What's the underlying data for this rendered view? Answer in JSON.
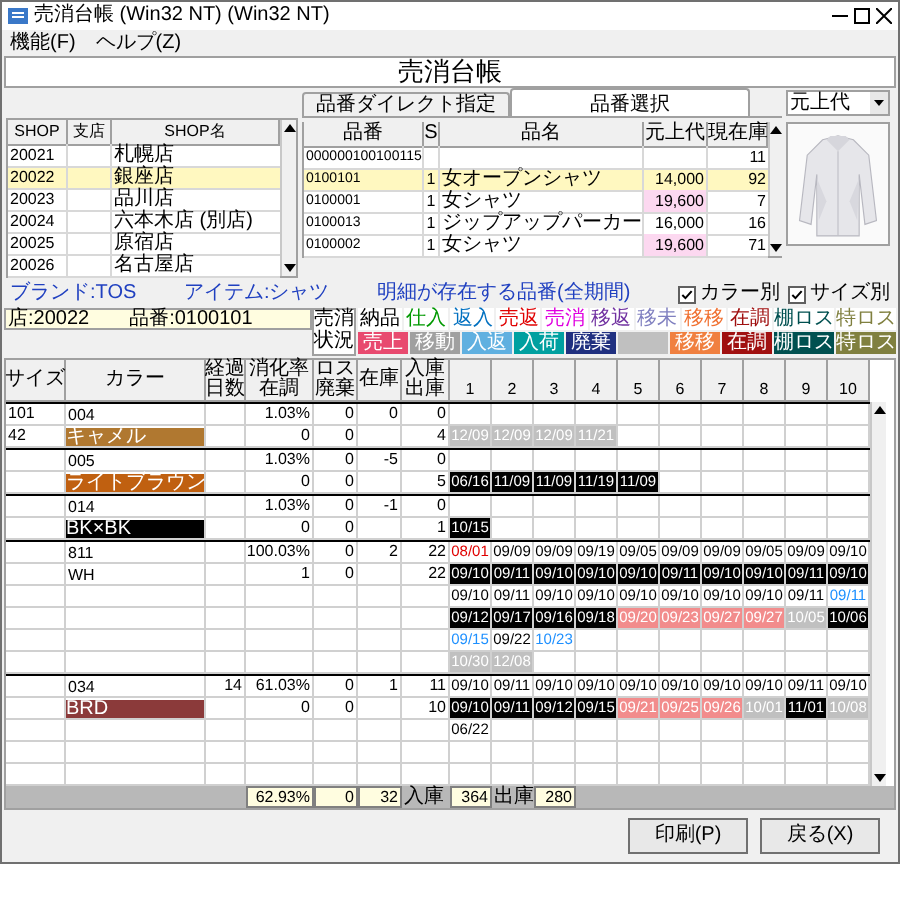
{
  "window": {
    "title": "売消台帳 (Win32 NT) (Win32 NT)"
  },
  "menu": [
    "機能(F)",
    "ヘルプ(Z)"
  ],
  "heading": "売消台帳",
  "shops": {
    "columns": [
      "SHOP",
      "支店",
      "SHOP名"
    ],
    "rows": [
      {
        "code": "20021",
        "name": "札幌店",
        "selected": false
      },
      {
        "code": "20022",
        "name": "銀座店",
        "selected": true
      },
      {
        "code": "20023",
        "name": "品川店",
        "selected": false
      },
      {
        "code": "20024",
        "name": "六本木店 (別店)",
        "selected": false
      },
      {
        "code": "20025",
        "name": "原宿店",
        "selected": false
      },
      {
        "code": "20026",
        "name": "名古屋店",
        "selected": false
      }
    ]
  },
  "tabs": [
    {
      "label": "品番ダイレクト指定",
      "selected": false
    },
    {
      "label": "品番選択",
      "selected": true
    }
  ],
  "price_select": {
    "value": "元上代"
  },
  "products": {
    "columns": [
      "品番",
      "S",
      "品名",
      "元上代",
      "現在庫"
    ],
    "rows": [
      {
        "code": "000000100100115",
        "stock": "11",
        "highlight": false,
        "selected": false
      },
      {
        "code": "0100101",
        "s": "1",
        "name": "女オープンシャツ",
        "price": "14,000",
        "stock": "92",
        "highlight": false,
        "selected": true
      },
      {
        "code": "0100001",
        "s": "1",
        "name": "女シャツ",
        "price": "19,600",
        "stock": "7",
        "highlight": true,
        "selected": false
      },
      {
        "code": "0100013",
        "s": "1",
        "name": "ジップアップパーカー",
        "price": "16,000",
        "stock": "16",
        "highlight": false,
        "selected": false
      },
      {
        "code": "0100002",
        "s": "1",
        "name": "女シャツ",
        "price": "19,600",
        "stock": "71",
        "highlight": true,
        "selected": false
      }
    ]
  },
  "info": {
    "brand": "ブランド:TOS",
    "item": "アイテム:シャツ",
    "filter": "明細が存在する品番(全期間)"
  },
  "options": [
    {
      "label": "カラー別",
      "checked": true
    },
    {
      "label": "サイズ別",
      "checked": true
    }
  ],
  "selection": {
    "shop": "店:20022",
    "code": "品番:0100101"
  },
  "legend": {
    "title": [
      "売消",
      "状況"
    ],
    "top": [
      {
        "label": "納品",
        "color": "#000000"
      },
      {
        "label": "仕入",
        "color": "#009900"
      },
      {
        "label": "返入",
        "color": "#0070c0"
      },
      {
        "label": "売返",
        "color": "#e00000"
      },
      {
        "label": "売消",
        "color": "#e000e0"
      },
      {
        "label": "移返",
        "color": "#7030a0"
      },
      {
        "label": "移未",
        "color": "#8080c0"
      },
      {
        "label": "移移",
        "color": "#f07030"
      },
      {
        "label": "在調",
        "color": "#a01010"
      },
      {
        "label": "棚ロス",
        "color": "#005050"
      },
      {
        "label": "特ロス",
        "color": "#808040"
      }
    ],
    "bottom": [
      {
        "label": "売上",
        "color": "#e84a6f"
      },
      {
        "label": "移動",
        "color": "#a0a0a0"
      },
      {
        "label": "入返",
        "color": "#60b0e0"
      },
      {
        "label": "入荷",
        "color": "#00a0a0"
      },
      {
        "label": "廃棄",
        "color": "#203080"
      },
      {
        "color": "#c0c0c0"
      },
      {
        "label": "移移",
        "color": "#f08040"
      },
      {
        "label": "在調",
        "color": "#a01010"
      },
      {
        "label": "棚ロス",
        "color": "#005050"
      },
      {
        "label": "特ロス",
        "color": "#808040"
      }
    ]
  },
  "grid": {
    "columns": [
      [
        "サイズ"
      ],
      [
        "カラー"
      ],
      [
        "経過",
        "日数"
      ],
      [
        "消化率",
        "在調"
      ],
      [
        "ロス",
        "廃棄"
      ],
      [
        "在庫"
      ],
      [
        "入庫",
        "出庫"
      ]
    ],
    "date_columns": [
      "1",
      "2",
      "3",
      "4",
      "5",
      "6",
      "7",
      "8",
      "9",
      "10"
    ],
    "rows": [
      {
        "divider": true,
        "size": "101",
        "color_label": "004",
        "rate": "1.03%",
        "loss": "0",
        "stock": "0",
        "io": "0"
      },
      {
        "divider": false,
        "size": "42",
        "color_label": "キャメル",
        "color": "#b07830",
        "rate": "0",
        "loss": "0",
        "io": "4",
        "dates": [
          {
            "text": "12/09",
            "kind": "gray"
          },
          {
            "text": "12/09",
            "kind": "gray"
          },
          {
            "text": "12/09",
            "kind": "gray"
          },
          {
            "text": "11/21",
            "kind": "gray"
          }
        ]
      },
      {
        "divider": true,
        "color_label": "005",
        "rate": "1.03%",
        "loss": "0",
        "stock": "-5",
        "io": "0"
      },
      {
        "divider": false,
        "color_label": "ライトブラウン",
        "color": "#c06010",
        "rate": "0",
        "loss": "0",
        "io": "5",
        "dates": [
          {
            "text": "06/16",
            "kind": "black"
          },
          {
            "text": "11/09",
            "kind": "black"
          },
          {
            "text": "11/09",
            "kind": "black"
          },
          {
            "text": "11/19",
            "kind": "black"
          },
          {
            "text": "11/09",
            "kind": "black"
          }
        ]
      },
      {
        "divider": true,
        "color_label": "014",
        "rate": "1.03%",
        "loss": "0",
        "stock": "-1",
        "io": "0"
      },
      {
        "divider": false,
        "color_label": "BK×BK",
        "color": "#000000",
        "rate": "0",
        "loss": "0",
        "io": "1",
        "dates": [
          {
            "text": "10/15",
            "kind": "black"
          }
        ]
      },
      {
        "divider": true,
        "color_label": "811",
        "rate": "100.03%",
        "loss": "0",
        "stock": "2",
        "io": "22",
        "dates": [
          {
            "text": "08/01",
            "kind": "red"
          },
          {
            "text": "09/09",
            "kind": "plain"
          },
          {
            "text": "09/09",
            "kind": "plain"
          },
          {
            "text": "09/19",
            "kind": "plain"
          },
          {
            "text": "09/05",
            "kind": "plain"
          },
          {
            "text": "09/09",
            "kind": "plain"
          },
          {
            "text": "09/09",
            "kind": "plain"
          },
          {
            "text": "09/05",
            "kind": "plain"
          },
          {
            "text": "09/09",
            "kind": "plain"
          },
          {
            "text": "09/10",
            "kind": "plain"
          }
        ]
      },
      {
        "divider": false,
        "color_label": "WH",
        "rate": "1",
        "loss": "0",
        "io": "22",
        "dates": [
          {
            "text": "09/10",
            "kind": "black"
          },
          {
            "text": "09/11",
            "kind": "black"
          },
          {
            "text": "09/10",
            "kind": "black"
          },
          {
            "text": "09/10",
            "kind": "black"
          },
          {
            "text": "09/10",
            "kind": "black"
          },
          {
            "text": "09/11",
            "kind": "black"
          },
          {
            "text": "09/10",
            "kind": "black"
          },
          {
            "text": "09/10",
            "kind": "black"
          },
          {
            "text": "09/11",
            "kind": "black"
          },
          {
            "text": "09/10",
            "kind": "black"
          }
        ]
      },
      {
        "divider": false,
        "dates": [
          {
            "text": "09/10",
            "kind": "plain"
          },
          {
            "text": "09/11",
            "kind": "plain"
          },
          {
            "text": "09/10",
            "kind": "plain"
          },
          {
            "text": "09/10",
            "kind": "plain"
          },
          {
            "text": "09/10",
            "kind": "plain"
          },
          {
            "text": "09/10",
            "kind": "plain"
          },
          {
            "text": "09/10",
            "kind": "plain"
          },
          {
            "text": "09/10",
            "kind": "plain"
          },
          {
            "text": "09/11",
            "kind": "plain"
          },
          {
            "text": "09/11",
            "kind": "blue"
          }
        ]
      },
      {
        "divider": false,
        "dates": [
          {
            "text": "09/12",
            "kind": "black"
          },
          {
            "text": "09/17",
            "kind": "black"
          },
          {
            "text": "09/16",
            "kind": "black"
          },
          {
            "text": "09/18",
            "kind": "black"
          },
          {
            "text": "09/20",
            "kind": "pink"
          },
          {
            "text": "09/23",
            "kind": "pink"
          },
          {
            "text": "09/27",
            "kind": "pink"
          },
          {
            "text": "09/27",
            "kind": "pink"
          },
          {
            "text": "10/05",
            "kind": "gray"
          },
          {
            "text": "10/06",
            "kind": "black"
          }
        ]
      },
      {
        "divider": false,
        "dates": [
          {
            "text": "09/15",
            "kind": "blue"
          },
          {
            "text": "09/22",
            "kind": "plain"
          },
          {
            "text": "10/23",
            "kind": "blue"
          }
        ]
      },
      {
        "divider": false,
        "dates": [
          {
            "text": "10/30",
            "kind": "gray"
          },
          {
            "text": "12/08",
            "kind": "gray"
          }
        ]
      },
      {
        "divider": true,
        "color_label": "034",
        "days": "14",
        "rate": "61.03%",
        "loss": "0",
        "stock": "1",
        "io": "11",
        "dates": [
          {
            "text": "09/10",
            "kind": "plain"
          },
          {
            "text": "09/11",
            "kind": "plain"
          },
          {
            "text": "09/10",
            "kind": "plain"
          },
          {
            "text": "09/10",
            "kind": "plain"
          },
          {
            "text": "09/10",
            "kind": "plain"
          },
          {
            "text": "09/10",
            "kind": "plain"
          },
          {
            "text": "09/10",
            "kind": "plain"
          },
          {
            "text": "09/10",
            "kind": "plain"
          },
          {
            "text": "09/11",
            "kind": "plain"
          },
          {
            "text": "09/10",
            "kind": "plain"
          }
        ]
      },
      {
        "divider": false,
        "color_label": "BRD",
        "color": "#8b3a3a",
        "rate": "0",
        "loss": "0",
        "io": "10",
        "dates": [
          {
            "text": "09/10",
            "kind": "black"
          },
          {
            "text": "09/11",
            "kind": "black"
          },
          {
            "text": "09/12",
            "kind": "black"
          },
          {
            "text": "09/15",
            "kind": "black"
          },
          {
            "text": "09/21",
            "kind": "pink"
          },
          {
            "text": "09/25",
            "kind": "pink"
          },
          {
            "text": "09/26",
            "kind": "pink"
          },
          {
            "text": "10/01",
            "kind": "gray"
          },
          {
            "text": "11/01",
            "kind": "black"
          },
          {
            "text": "10/08",
            "kind": "gray"
          }
        ]
      },
      {
        "divider": false,
        "dates": [
          {
            "text": "06/22",
            "kind": "plain"
          }
        ]
      }
    ],
    "totals": {
      "rate": "62.93%",
      "loss": "0",
      "stock": "32",
      "in_label": "入庫",
      "in": "364",
      "out_label": "出庫",
      "out": "280"
    }
  },
  "buttons": [
    "印刷(P)",
    "戻る(X)"
  ]
}
